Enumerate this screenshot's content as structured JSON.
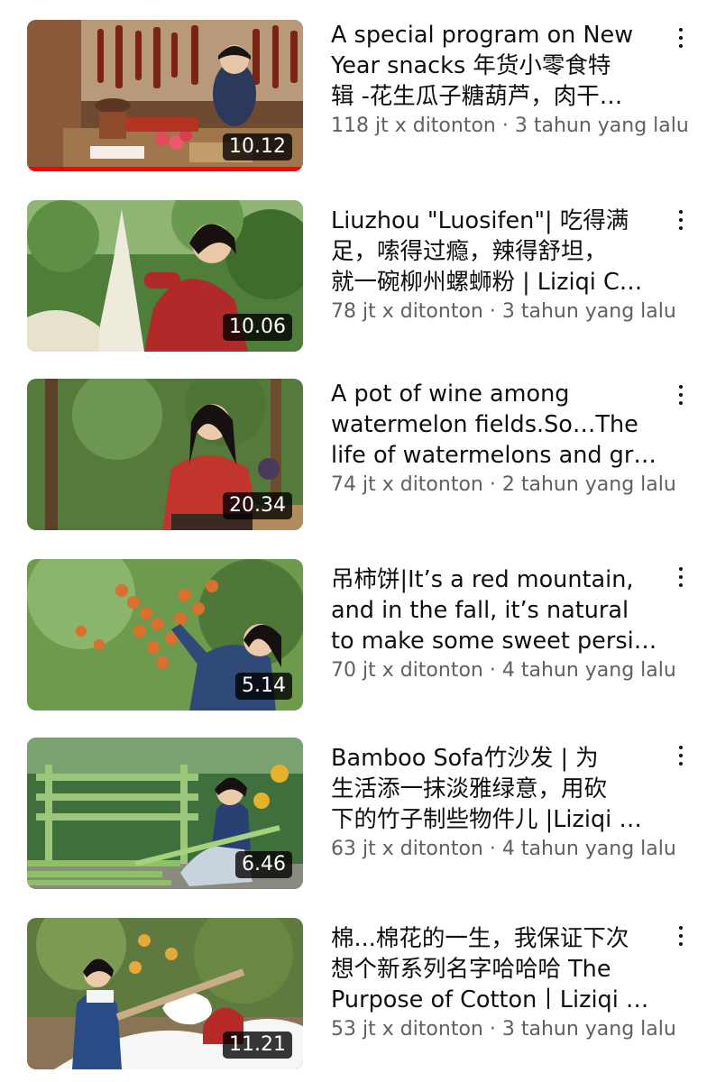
{
  "videos": [
    {
      "title_lines": [
        "A special program on New",
        "Year snacks  年货小零食特",
        "辑 -花生瓜子糖葫芦，肉干…"
      ],
      "views": "118 jt x ditonton",
      "age": "3 tahun yang lalu",
      "duration": "10.12",
      "watched_progress": 1.0
    },
    {
      "title_lines": [
        "Liuzhou \"Luosifen\"| 吃得满",
        "足，嗦得过瘾，辣得舒坦，",
        "就一碗柳州螺蛳粉 | Liziqi C…"
      ],
      "views": "78 jt x ditonton",
      "age": "3 tahun yang lalu",
      "duration": "10.06"
    },
    {
      "title_lines": [
        "A pot of wine among",
        "watermelon fields.So…The",
        "life of watermelons and gr…"
      ],
      "views": "74 jt x ditonton",
      "age": "2 tahun yang lalu",
      "duration": "20.34"
    },
    {
      "title_lines": [
        "吊柿饼|It’s a red mountain,",
        "and in the fall, it’s natural",
        "to make some sweet persi…"
      ],
      "views": "70 jt x ditonton",
      "age": "4 tahun yang lalu",
      "duration": "5.14"
    },
    {
      "title_lines": [
        "Bamboo Sofa竹沙发 | 为",
        "生活添一抹淡雅绿意，用砍",
        "下的竹子制些物件儿 |Liziqi …"
      ],
      "views": "63 jt x ditonton",
      "age": "4 tahun yang lalu",
      "duration": "6.46"
    },
    {
      "title_lines": [
        "棉...棉花的一生，我保证下次",
        "想个新系列名字哈哈哈 The",
        "Purpose of Cotton丨Liziqi …"
      ],
      "views": "53 jt x ditonton",
      "age": "3 tahun yang lalu",
      "duration": "11.21"
    }
  ],
  "separator": " · ",
  "colors": {
    "progress": "#ff0000",
    "text": "#0f0f0f",
    "meta": "#606060"
  },
  "icons": {
    "more": "kebab-menu-icon"
  }
}
